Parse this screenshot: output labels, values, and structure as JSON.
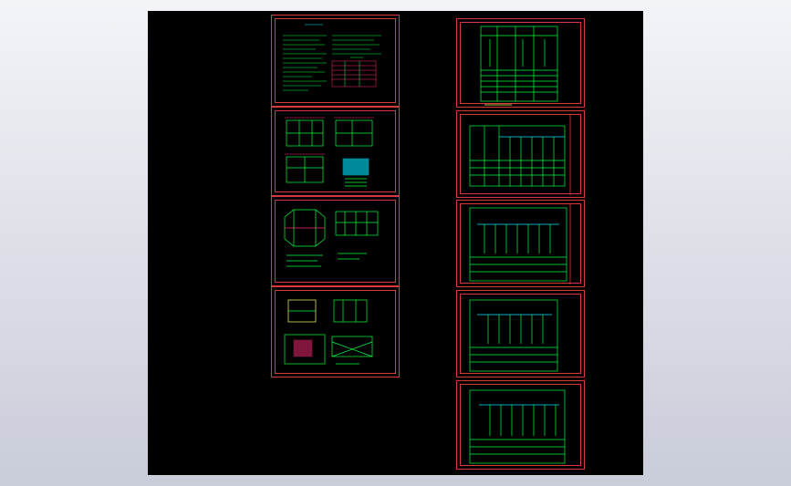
{
  "viewport": {
    "background": "#000000",
    "frame_color": "#d8393c",
    "line_color": "#00ff3c",
    "accent_color": "#00e5ff",
    "highlight_color": "#ff2d7a"
  },
  "sheets": {
    "left": [
      {
        "name": "sheet-design-notes",
        "kind": "notes"
      },
      {
        "name": "sheet-floor-plans",
        "kind": "plans"
      },
      {
        "name": "sheet-roof-elevation",
        "kind": "elevation"
      },
      {
        "name": "sheet-details",
        "kind": "details"
      }
    ],
    "right": [
      {
        "name": "sheet-system-diagram",
        "kind": "system"
      },
      {
        "name": "sheet-distribution-board-1",
        "kind": "schedule"
      },
      {
        "name": "sheet-distribution-board-2",
        "kind": "schedule"
      },
      {
        "name": "sheet-distribution-board-3",
        "kind": "schedule"
      },
      {
        "name": "sheet-distribution-board-4",
        "kind": "schedule"
      }
    ]
  }
}
